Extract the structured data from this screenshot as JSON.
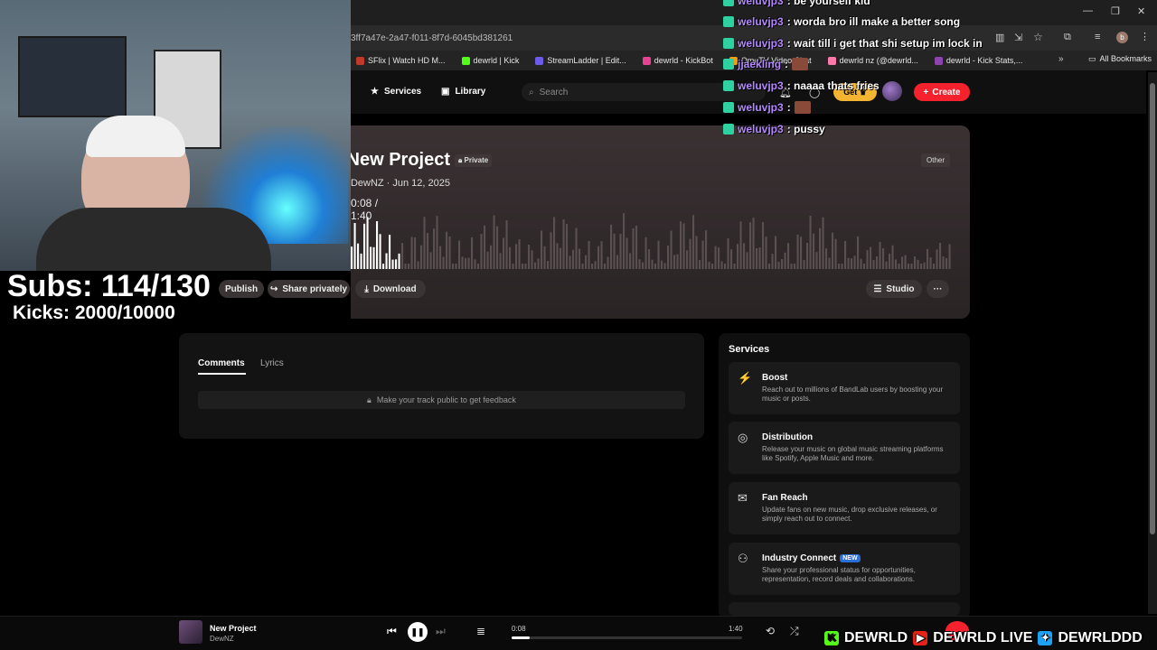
{
  "browser": {
    "url": "3ff7a47e-2a47-f011-8f7d-6045bd381261",
    "bookmarks": [
      {
        "label": "SFlix | Watch HD M...",
        "color": "#c0392b"
      },
      {
        "label": "dewrld | Kick",
        "color": "#53fc18"
      },
      {
        "label": "StreamLadder | Edit...",
        "color": "#6c5ce7"
      },
      {
        "label": "dewrld - KickBot",
        "color": "#e84393"
      },
      {
        "label": "OmeTV Video Chat",
        "color": "#f39c12"
      },
      {
        "label": "dewrld nz (@dewrld...",
        "color": "#fd79a8"
      },
      {
        "label": "dewrld - Kick Stats,...",
        "color": "#8e44ad"
      }
    ],
    "all_bookmarks": "All Bookmarks",
    "profile_initial": "b"
  },
  "nav": {
    "services": "Services",
    "library": "Library",
    "search_placeholder": "Search",
    "get": "Get",
    "create": "Create"
  },
  "project": {
    "title": "New Project",
    "privacy": "Private",
    "meta": "DewNZ · Jun 12, 2025",
    "time": "0:08 / 1:40",
    "genre": "Other",
    "progress": 0.08
  },
  "actions": {
    "publish": "Publish",
    "share": "Share privately",
    "download": "Download",
    "studio": "Studio",
    "more": "···"
  },
  "comments": {
    "tab_comments": "Comments",
    "tab_lyrics": "Lyrics",
    "feedback": "Make your track public to get feedback"
  },
  "services": {
    "title": "Services",
    "items": [
      {
        "icon": "⚡",
        "title": "Boost",
        "desc": "Reach out to millions of BandLab users by boosting your music or posts."
      },
      {
        "icon": "◎",
        "title": "Distribution",
        "desc": "Release your music on global music streaming platforms like Spotify, Apple Music and more."
      },
      {
        "icon": "✉",
        "title": "Fan Reach",
        "desc": "Update fans on new music, drop exclusive releases, or simply reach out to connect."
      },
      {
        "icon": "⚇",
        "title": "Industry Connect",
        "badge": "NEW",
        "desc": "Share your professional status for opportunities, representation, record deals and collaborations."
      }
    ]
  },
  "player": {
    "title": "New Project",
    "artist": "DewNZ",
    "current": "0:08",
    "duration": "1:40",
    "progress": 0.08
  },
  "overlay": {
    "subs": "Subs: 114/130",
    "kicks": "Kicks: 2000/10000"
  },
  "chat": [
    {
      "user": "weluvjp3",
      "msg": ": be yourself kid"
    },
    {
      "user": "weluvjp3",
      "msg": ": worda bro ill make a better song"
    },
    {
      "user": "weluvjp3",
      "msg": ": wait till i get that shi setup im lock in"
    },
    {
      "user": "jjaekling",
      "msg": ":"
    },
    {
      "user": "weluvjp3",
      "msg": ": naaaa thats fries"
    },
    {
      "user": "weluvjp3",
      "msg": ":"
    },
    {
      "user": "weluvjp3",
      "msg": ": pussy"
    }
  ],
  "socials": {
    "kick": "DEWRLD",
    "youtube": "DEWRLD LIVE",
    "twitter": "DEWRLDDD"
  },
  "colors": {
    "accent_red": "#f5222d",
    "get_yellow": "#f3b431",
    "chat_user": "#b588ff",
    "hero_bg": "#3a3133"
  }
}
